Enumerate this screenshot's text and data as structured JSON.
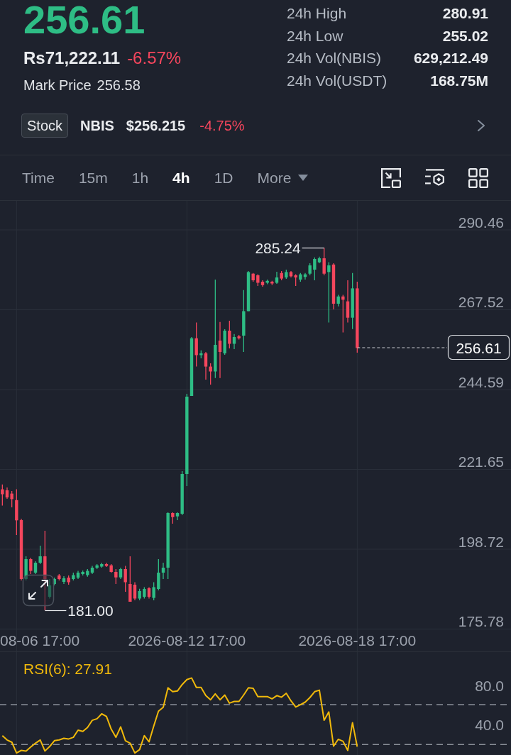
{
  "ticker": {
    "last_price": "256.61",
    "price_falling": false,
    "local_price": "Rs71,222.11",
    "change": "-6.57%",
    "change_falling": true,
    "mark_price_label": "Mark Price",
    "mark_price": "256.58"
  },
  "stats": [
    {
      "label": "24h High",
      "value": "280.91"
    },
    {
      "label": "24h Low",
      "value": "255.02"
    },
    {
      "label": "24h Vol(NBIS)",
      "value": "629,212.49"
    },
    {
      "label": "24h Vol(USDT)",
      "value": "168.75M"
    }
  ],
  "stock": {
    "tag": "Stock",
    "symbol": "NBIS",
    "price": "$256.215",
    "change": "-4.75%",
    "change_falling": true
  },
  "intervals": [
    {
      "label": "Time",
      "kind": "interval",
      "selected": false
    },
    {
      "label": "15m",
      "kind": "interval",
      "selected": false
    },
    {
      "label": "1h",
      "kind": "interval",
      "selected": false
    },
    {
      "label": "4h",
      "kind": "interval",
      "selected": true
    },
    {
      "label": "1D",
      "kind": "interval",
      "selected": false
    },
    {
      "label": "More",
      "kind": "menu",
      "selected": false
    }
  ],
  "chart": {
    "price_axis": [
      "290.46",
      "267.52",
      "244.59",
      "221.65",
      "198.72",
      "175.78"
    ],
    "time_axis": [
      "08-06 17:00",
      "2026-08-12 17:00",
      "2026-08-18 17:00"
    ],
    "high_marker": "285.24",
    "low_marker": "181.00",
    "last_price": "256.61"
  },
  "rsi": {
    "chart_data": {
      "type": "line",
      "title": "RSI(6): 27.91",
      "categories": [
        null,
        null,
        null,
        null,
        null,
        null,
        null,
        null,
        null,
        null,
        null,
        null,
        null,
        null,
        null,
        null,
        null,
        null,
        null,
        null,
        null,
        null,
        null,
        null,
        null,
        null,
        null,
        null,
        null,
        null,
        null,
        null,
        null,
        null,
        null,
        null,
        null,
        null,
        null,
        null,
        null,
        null,
        null,
        null,
        null,
        null,
        null,
        null,
        null,
        null,
        null,
        null,
        null,
        null,
        null,
        null,
        null,
        null,
        null,
        null,
        null,
        null,
        null,
        null,
        null,
        null,
        null,
        null,
        null,
        null,
        null,
        null,
        null,
        null,
        null,
        null,
        null,
        null,
        null,
        null,
        null,
        null,
        null,
        null,
        null,
        null,
        null,
        null,
        null,
        null,
        null,
        null,
        null,
        null,
        null,
        null,
        null,
        null,
        null,
        null,
        null,
        null,
        null,
        null,
        null,
        null,
        null,
        null
      ],
      "ylim": [
        9.2,
        114.5
      ],
      "yticks": [
        {
          "value": 80,
          "label": "80.0"
        },
        {
          "value": 40,
          "label": "40.0"
        }
      ],
      "grid": true,
      "series": [
        {
          "color": "#f0b90b",
          "values": [
            29.0,
            24.6,
            22.3,
            11.3,
            13.9,
            13.3,
            17.3,
            21.3,
            24.6,
            13.3,
            17.9,
            23.9,
            24.6,
            26.3,
            25.6,
            27.3,
            34.6,
            33.3,
            37.4,
            44.7,
            46.3,
            51.3,
            48.7,
            35.6,
            27.3,
            38.0,
            23.9,
            21.3,
            11.3,
            14.7,
            29.0,
            22.6,
            39.0,
            54.0,
            58.0,
            78.0,
            74.0,
            74.7,
            81.3,
            86.3,
            88.1,
            78.4,
            78.4,
            70.0,
            65.7,
            71.7,
            65.7,
            70.6,
            62.3,
            64.0,
            64.0,
            70.6,
            78.0,
            77.4,
            69.0,
            69.0,
            69.0,
            66.7,
            70.0,
            68.3,
            72.4,
            64.6,
            58.3,
            60.7,
            63.3,
            68.0,
            74.0,
            75.6,
            44.7,
            53.3,
            18.3,
            25.3,
            23.3,
            13.9,
            42.3,
            17.8,
            null,
            null,
            null,
            null,
            null,
            null,
            null,
            null,
            null,
            null,
            null,
            null,
            null,
            null,
            null,
            null,
            null,
            null,
            null,
            null,
            null,
            null,
            null,
            null,
            null,
            null,
            null,
            null,
            null,
            null,
            null,
            null
          ]
        }
      ],
      "ref_lines": [
        {
          "axis": "y",
          "value": 60.7
        },
        {
          "axis": "y",
          "value": 20.0
        }
      ]
    }
  }
}
